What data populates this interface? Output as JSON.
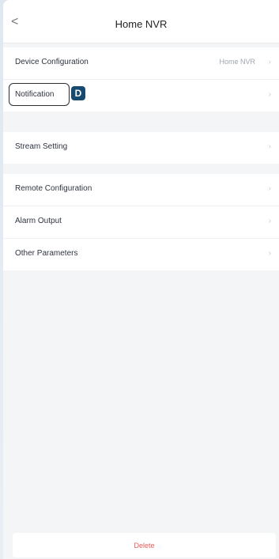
{
  "header": {
    "title": "Home NVR",
    "back_icon": "chevron-left-icon"
  },
  "groups": [
    {
      "items": [
        {
          "label": "Device Configuration",
          "value": "Home NVR",
          "chevron": "›"
        },
        {
          "label": "Notification",
          "value": "",
          "chevron": "›"
        }
      ]
    },
    {
      "items": [
        {
          "label": "Stream Setting",
          "value": "",
          "chevron": "›"
        }
      ]
    },
    {
      "items": [
        {
          "label": "Remote Configuration",
          "value": "",
          "chevron": "›"
        },
        {
          "label": "Alarm Output",
          "value": "",
          "chevron": "›"
        },
        {
          "label": "Other Parameters",
          "value": "",
          "chevron": "›"
        }
      ]
    }
  ],
  "overlay": {
    "focus_label": "D"
  },
  "footer": {
    "delete_label": "Delete"
  },
  "colors": {
    "delete_text": "#e45b5b",
    "badge_bg": "#174a6e"
  }
}
